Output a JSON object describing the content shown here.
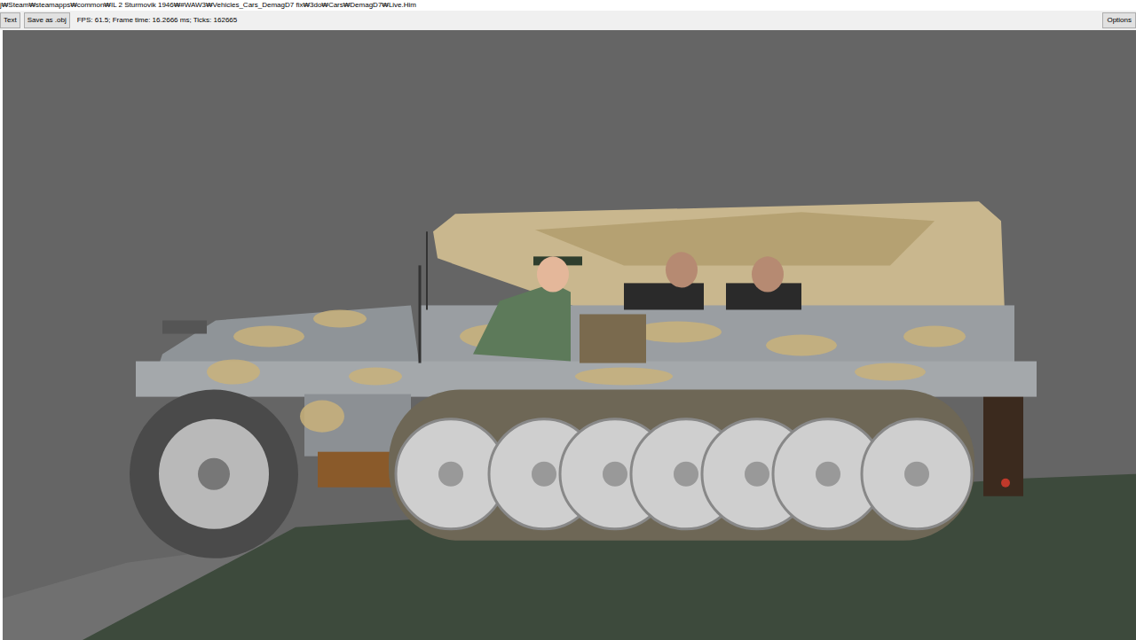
{
  "window": {
    "title": "j₩Steam₩steamapps₩common₩IL 2 Sturmovik 1946₩#WAW3₩Vehicles_Cars_DemagD7 fix₩3do₩Cars₩DemagD7₩Live.Him"
  },
  "toolbar": {
    "buttons": [
      {
        "label": "Text"
      },
      {
        "label": "Save as .obj"
      }
    ],
    "status": "FPS: 61.5; Frame time: 16.2666 ms; Ticks: 162665",
    "options": {
      "label": "Options"
    }
  }
}
